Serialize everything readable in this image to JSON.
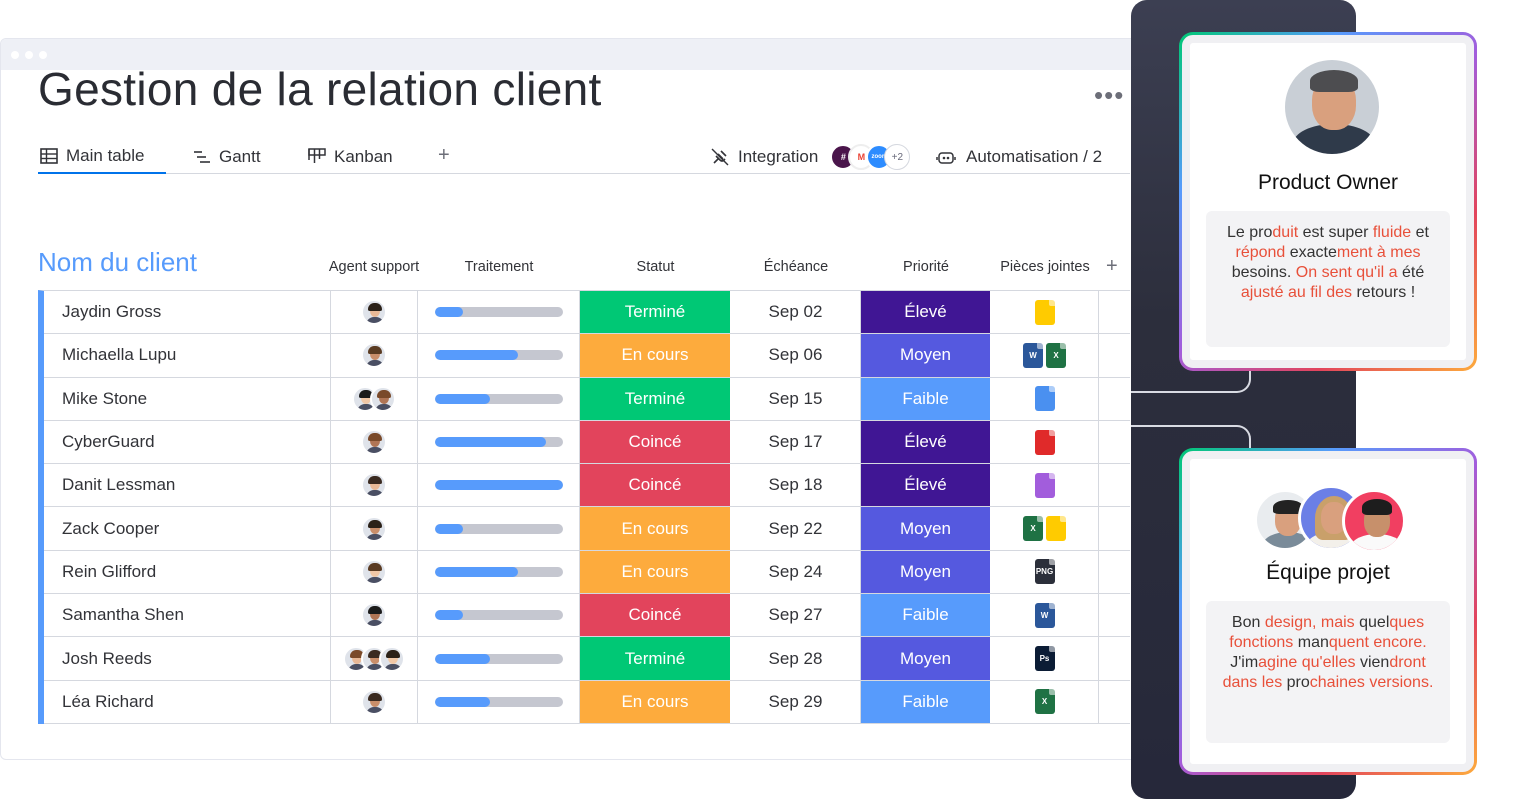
{
  "board": {
    "title": "Gestion de la relation client",
    "more_label": "•••",
    "tabs": [
      {
        "label": "Main table",
        "icon": "table-icon"
      },
      {
        "label": "Gantt",
        "icon": "gantt-icon"
      },
      {
        "label": "Kanban",
        "icon": "kanban-icon"
      }
    ],
    "add_tab_label": "+",
    "integration_label": "Integration",
    "integration_extra": "+2",
    "integration_zoom": "zoom",
    "automation_label": "Automatisation / 2",
    "group_title": "Nom du client",
    "columns": [
      "Agent support",
      "Traitement",
      "Statut",
      "Échéance",
      "Priorité",
      "Pièces jointes"
    ],
    "add_column_label": "+",
    "rows": [
      {
        "name": "Jaydin Gross",
        "agents": 1,
        "progress": 0.22,
        "status": "Terminé",
        "due": "Sep 02",
        "priority": "Élevé",
        "files": [
          "zip"
        ]
      },
      {
        "name": "Michaella Lupu",
        "agents": 1,
        "progress": 0.65,
        "status": "En cours",
        "due": "Sep 06",
        "priority": "Moyen",
        "files": [
          "word",
          "excel"
        ]
      },
      {
        "name": "Mike Stone",
        "agents": 2,
        "progress": 0.43,
        "status": "Terminé",
        "due": "Sep 15",
        "priority": "Faible",
        "files": [
          "image"
        ]
      },
      {
        "name": "CyberGuard",
        "agents": 1,
        "progress": 0.87,
        "status": "Coincé",
        "due": "Sep 17",
        "priority": "Élevé",
        "files": [
          "pdf"
        ]
      },
      {
        "name": "Danit Lessman",
        "agents": 1,
        "progress": 1.0,
        "status": "Coincé",
        "due": "Sep 18",
        "priority": "Élevé",
        "files": [
          "video"
        ]
      },
      {
        "name": "Zack Cooper",
        "agents": 1,
        "progress": 0.22,
        "status": "En cours",
        "due": "Sep 22",
        "priority": "Moyen",
        "files": [
          "excel",
          "zip"
        ]
      },
      {
        "name": "Rein Glifford",
        "agents": 1,
        "progress": 0.65,
        "status": "En cours",
        "due": "Sep 24",
        "priority": "Moyen",
        "files": [
          "png"
        ]
      },
      {
        "name": "Samantha Shen",
        "agents": 1,
        "progress": 0.22,
        "status": "Coincé",
        "due": "Sep 27",
        "priority": "Faible",
        "files": [
          "word"
        ]
      },
      {
        "name": "Josh Reeds",
        "agents": 3,
        "progress": 0.43,
        "status": "Terminé",
        "due": "Sep 28",
        "priority": "Moyen",
        "files": [
          "photoshop"
        ]
      },
      {
        "name": "Léa Richard",
        "agents": 1,
        "progress": 0.43,
        "status": "En cours",
        "due": "Sep 29",
        "priority": "Faible",
        "files": [
          "excel"
        ]
      }
    ]
  },
  "file_labels": {
    "word": "W",
    "excel": "X",
    "png": "PNG",
    "photoshop": "Ps"
  },
  "status_colors": {
    "Terminé": "#00c875",
    "En cours": "#fdab3d",
    "Coincé": "#e2445c"
  },
  "priority_colors": {
    "Élevé": "#401694",
    "Moyen": "#5559df",
    "Faible": "#579bfc"
  },
  "cards": [
    {
      "role": "Product Owner",
      "quote_parts": [
        "Le pro",
        "duit ",
        "est super",
        " fluide ",
        "et ",
        "répond",
        " exacte",
        "ment à mes",
        " besoins. ",
        "On sent qu'il a",
        " été ",
        "ajusté au fil des",
        " retours !"
      ]
    },
    {
      "role": "Équipe projet",
      "quote_parts": [
        "Bon ",
        "design, mais",
        " quel",
        "ques fonctions",
        " man",
        "quent encore.",
        " J'im",
        "agine qu'elles",
        " vien",
        "dront dans les",
        " pro",
        "chaines versions."
      ]
    }
  ]
}
